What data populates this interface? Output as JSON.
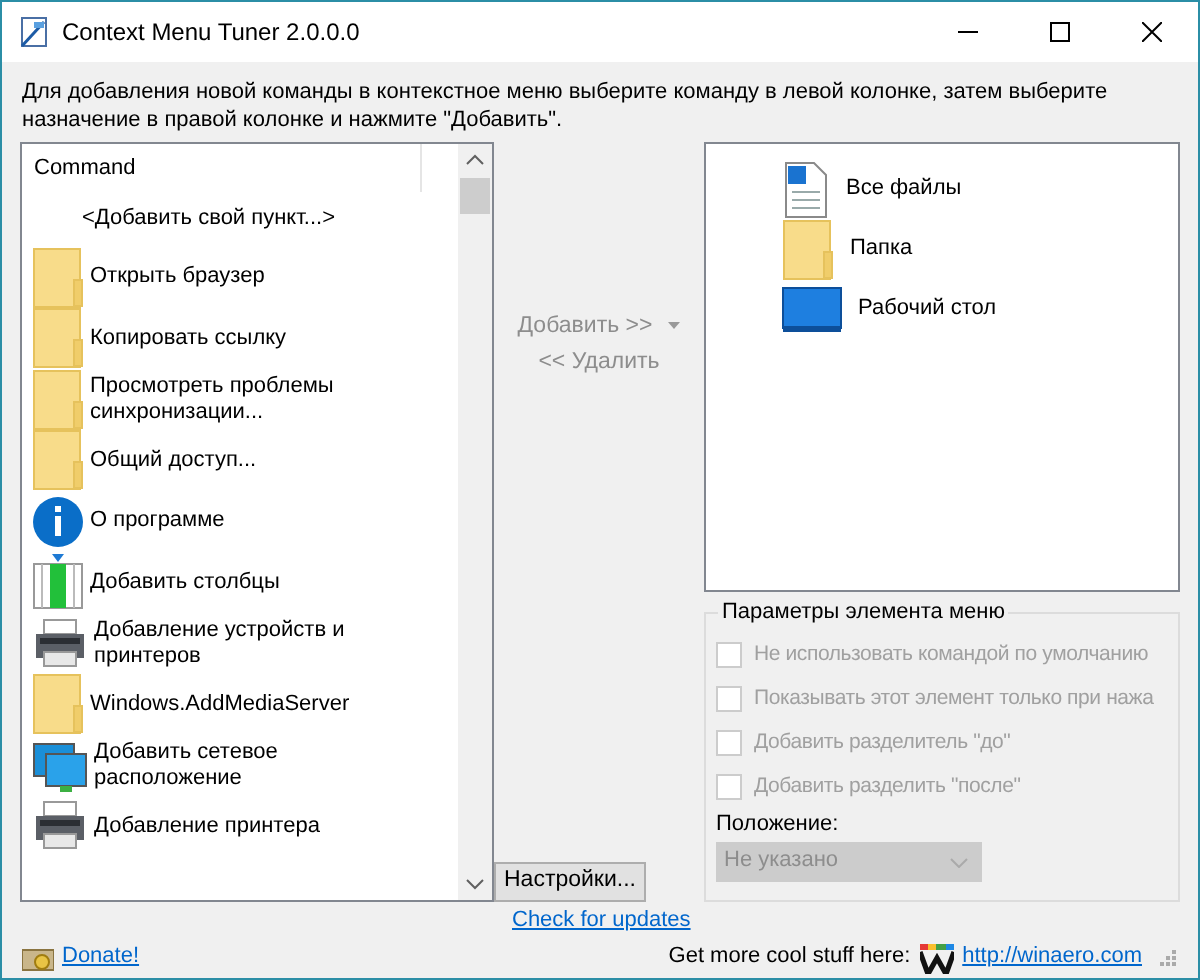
{
  "window": {
    "title": "Context Menu Tuner 2.0.0.0"
  },
  "instruction": "Для добавления новой команды в контекстное меню выберите команду в левой колонке, затем выберите назначение в правой колонке и нажмите \"Добавить\".",
  "commands": {
    "header": "Command",
    "items": [
      {
        "label": "<Добавить свой пункт...>",
        "kind": "none"
      },
      {
        "label": "Открыть браузер",
        "kind": "folder"
      },
      {
        "label": "Копировать ссылку",
        "kind": "folder"
      },
      {
        "label": "Просмотреть проблемы синхронизации...",
        "kind": "folder"
      },
      {
        "label": "Общий доступ...",
        "kind": "folder"
      },
      {
        "label": "О программе",
        "kind": "info"
      },
      {
        "label": "Добавить столбцы",
        "kind": "columns"
      },
      {
        "label": "Добавление устройств и принтеров",
        "kind": "printer"
      },
      {
        "label": "Windows.AddMediaServer",
        "kind": "folder"
      },
      {
        "label": "Добавить сетевое расположение",
        "kind": "network"
      },
      {
        "label": "Добавление принтера",
        "kind": "printer"
      }
    ]
  },
  "actions": [
    {
      "label": "Добавить >>",
      "disabled": true,
      "dropdown": true
    },
    {
      "label": "<< Удалить",
      "disabled": true,
      "dropdown": false
    }
  ],
  "targets": [
    {
      "label": "Все файлы",
      "kind": "file"
    },
    {
      "label": "Папка",
      "kind": "folder"
    },
    {
      "label": "Рабочий стол",
      "kind": "desktop"
    }
  ],
  "options": {
    "title": "Параметры элемента меню",
    "checkboxes": [
      {
        "label": "Не использовать командой по умолчанию",
        "checked": false,
        "disabled": true
      },
      {
        "label": "Показывать этот элемент только при нажа",
        "checked": false,
        "disabled": true
      },
      {
        "label": "Добавить разделитель \"до\"",
        "checked": false,
        "disabled": true
      },
      {
        "label": "Добавить разделить \"после\"",
        "checked": false,
        "disabled": true
      }
    ],
    "position_label": "Положение:",
    "position": {
      "value": "Не указано",
      "disabled": true
    }
  },
  "settings_button": "Настройки...",
  "check_updates": "Check for updates",
  "donate": "Donate!",
  "footer_text": "Get more cool stuff here:",
  "footer_link": "http://winaero.com"
}
